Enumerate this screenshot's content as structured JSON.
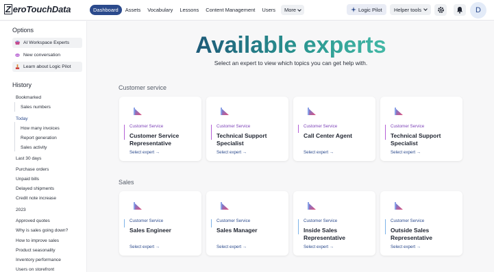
{
  "brand": {
    "name": "ZeroTouchData",
    "initial": "Z",
    "rest": "eroTouchData"
  },
  "nav": {
    "items": [
      "Dashboard",
      "Assets",
      "Vocabulary",
      "Lessons",
      "Content Management",
      "Users"
    ],
    "more": "More",
    "active": 0
  },
  "header": {
    "logic_pilot": "Logic Pilot",
    "helper_tools": "Helper tools",
    "avatar_initial": "D"
  },
  "sidebar": {
    "options_title": "Options",
    "options": [
      "AI Workspace Experts",
      "New conversation",
      "Learn about Logic Pilot"
    ],
    "history_title": "History",
    "history": [
      {
        "label": "Bookmarked",
        "level": "sec"
      },
      {
        "label": "Sales numbers",
        "level": "sub"
      },
      {
        "label": "Today",
        "level": "sec",
        "selected": true
      },
      {
        "label": "How many invoices",
        "level": "sub"
      },
      {
        "label": "Report generation",
        "level": "sub"
      },
      {
        "label": "Sales activity",
        "level": "sub"
      },
      {
        "label": "Last 30 days",
        "level": "sec"
      },
      {
        "label": "Purchase orders",
        "level": "sec"
      },
      {
        "label": "Unpaid bills",
        "level": "sec"
      },
      {
        "label": "Delayed shipments",
        "level": "sec"
      },
      {
        "label": "Credit note increase",
        "level": "sec"
      },
      {
        "label": "2023",
        "level": "sec"
      },
      {
        "label": "Approved quotes",
        "level": "sec"
      },
      {
        "label": "Why is sales going down?",
        "level": "sec"
      },
      {
        "label": "How to improve sales",
        "level": "sec"
      },
      {
        "label": "Product seasonality",
        "level": "sec"
      },
      {
        "label": "Inventory performance",
        "level": "sec"
      },
      {
        "label": "Users on storefront",
        "level": "sec"
      }
    ]
  },
  "main": {
    "title": "Available experts",
    "subtitle": "Select an expert to view which topics you can get help with.",
    "select_label": "Select expert →",
    "categories": [
      {
        "name": "Customer service",
        "tag": "Customer Service",
        "experts": [
          "Customer Service Representative",
          "Technical Support Specialist",
          "Call Center Agent",
          "Technical Support Specialist"
        ]
      },
      {
        "name": "Sales",
        "tag": "Customer Service",
        "experts": [
          "Sales Engineer",
          "Sales Manager",
          "Inside Sales Representative",
          "Outside Sales Representative"
        ]
      }
    ]
  },
  "colors": {
    "accent": "#2b4a8c",
    "title_gradient": [
      "#1d5a78",
      "#43b8a6"
    ],
    "cs_tag": "#7b3fb6"
  },
  "icons": {
    "options": [
      "workspace-icon",
      "conversation-icon",
      "learn-icon"
    ],
    "header": [
      "sparkle-icon",
      "gear-icon",
      "bell-icon"
    ]
  }
}
